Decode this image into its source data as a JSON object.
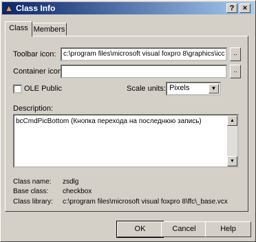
{
  "window": {
    "title": "Class Info",
    "close_glyph": "×",
    "help_glyph": "?"
  },
  "tabs": [
    {
      "label": "Class"
    },
    {
      "label": "Members"
    }
  ],
  "form": {
    "toolbar_icon_label": "Toolbar icon:",
    "toolbar_icon_value": "c:\\program files\\microsoft visual foxpro 8\\graphics\\icc",
    "container_icon_label": "Container icon:",
    "container_icon_value": "",
    "browse_glyph": "..",
    "ole_public_label": "OLE Public",
    "scale_units_label": "Scale units:",
    "scale_units_value": "Pixels",
    "description_label": "Description:",
    "description_value": "bcCmdPicBottom (Кнопка перехода на последнюю запись)"
  },
  "class_info": {
    "name_label": "Class name:",
    "name_value": "zsdlg",
    "base_label": "Base class:",
    "base_value": "checkbox",
    "library_label": "Class library:",
    "library_value": "c:\\program files\\microsoft visual foxpro 8\\ffc\\_base.vcx"
  },
  "buttons": {
    "ok": "OK",
    "cancel": "Cancel",
    "help": "Help"
  }
}
